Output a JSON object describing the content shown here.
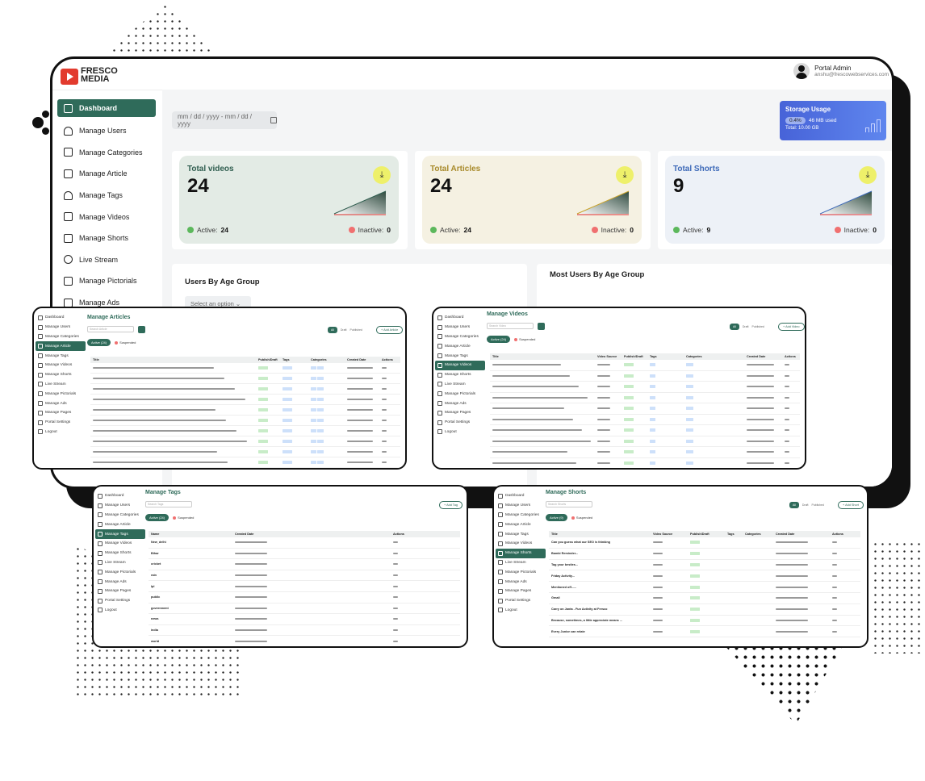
{
  "app": {
    "logo_line1": "FRESCO",
    "logo_line2": "MEDIA"
  },
  "user": {
    "name": "Portal Admin",
    "email": "anshu@frescowebservices.com"
  },
  "sidebar": {
    "items": [
      {
        "label": "Dashboard",
        "icon": "home-icon",
        "active": true
      },
      {
        "label": "Manage Users",
        "icon": "users-icon"
      },
      {
        "label": "Manage Categories",
        "icon": "categories-icon"
      },
      {
        "label": "Manage Article",
        "icon": "article-icon"
      },
      {
        "label": "Manage Tags",
        "icon": "tag-icon"
      },
      {
        "label": "Manage Videos",
        "icon": "video-icon"
      },
      {
        "label": "Manage Shorts",
        "icon": "shorts-icon"
      },
      {
        "label": "Live Stream",
        "icon": "broadcast-icon"
      },
      {
        "label": "Manage Pictorials",
        "icon": "image-icon"
      },
      {
        "label": "Manage Ads",
        "icon": "ads-icon"
      }
    ]
  },
  "date_range": {
    "placeholder": "mm / dd / yyyy  -  mm / dd / yyyy"
  },
  "storage": {
    "title": "Storage Usage",
    "percent": "0.4%",
    "used": "46 MB used",
    "total": "Total: 10.00 GB"
  },
  "cards": [
    {
      "title": "Total videos",
      "count": "24",
      "active_label": "Active:",
      "active": "24",
      "inactive_label": "Inactive:",
      "inactive": "0",
      "bg": "#e3ebe5",
      "title_color": "#2f5d4f",
      "line": "#2f5d4f"
    },
    {
      "title": "Total Articles",
      "count": "24",
      "active_label": "Active:",
      "active": "24",
      "inactive_label": "Inactive:",
      "inactive": "0",
      "bg": "#f5f1e2",
      "title_color": "#a88a2a",
      "line": "#c9a227"
    },
    {
      "title": "Total Shorts",
      "count": "9",
      "active_label": "Active:",
      "active": "9",
      "inactive_label": "Inactive:",
      "inactive": "0",
      "bg": "#edf1f7",
      "title_color": "#3d69b8",
      "line": "#3d69b8"
    }
  ],
  "panels": {
    "age_group": "Users By Age Group",
    "select_placeholder": "Select an option",
    "most_users": "Most Users By Age Group"
  },
  "articles_shot": {
    "title": "Manage Articles",
    "search": "Search Article",
    "filters": [
      "All",
      "Draft",
      "Published"
    ],
    "add": "+ Add Article",
    "chip_active": "Active (24)",
    "chip_suspended": "Suspended",
    "columns": [
      "Title",
      "Publish/Draft",
      "Tags",
      "Categories",
      "Created Date",
      "Actions"
    ]
  },
  "videos_shot": {
    "title": "Manage Videos",
    "search": "Search Video",
    "filters": [
      "All",
      "Draft",
      "Published"
    ],
    "add": "+ Add Video",
    "chip_active": "Active (24)",
    "chip_suspended": "Suspended",
    "columns": [
      "Title",
      "Video Source",
      "Publish/Draft",
      "Tags",
      "Categories",
      "Created Date",
      "Actions"
    ]
  },
  "tags_shot": {
    "title": "Manage Tags",
    "search": "Search Tags",
    "add": "+ Add Tag",
    "chip_active": "Active (24)",
    "chip_suspended": "Suspended",
    "columns": [
      "Name",
      "Created Date",
      "Actions"
    ],
    "rows": [
      "New_delhi",
      "Bihar",
      "cricket",
      "rain",
      "lpl",
      "public",
      "government",
      "news",
      "india",
      "world"
    ]
  },
  "shorts_shot": {
    "title": "Manage Shorts",
    "search": "Search Shorts",
    "filters": [
      "All",
      "Draft",
      "Published"
    ],
    "add": "+ Add Short",
    "chip_active": "Active (9)",
    "chip_suspended": "Suspended",
    "columns": [
      "Title",
      "Video Source",
      "Publish/Draft",
      "Tags",
      "Categories",
      "Created Date",
      "Actions"
    ],
    "rows": [
      "Can you guess what our SEO is thinking",
      "Bambi Reminder...",
      "Tag your besties...",
      "Friday Activity...",
      "Mentioned off......",
      "Gmail",
      "Carry on Janta - Fun Activity at Fresco",
      "Because, sometimes, a little appreciate means ...",
      "Every Junior can relate"
    ]
  },
  "mini_sidebar": [
    "Dashboard",
    "Manage Users",
    "Manage Categories",
    "Manage Article",
    "Manage Tags",
    "Manage Videos",
    "Manage Shorts",
    "Live Stream",
    "Manage Pictorials",
    "Manage Ads",
    "Manage Pages",
    "Portal Settings",
    "Logout"
  ]
}
